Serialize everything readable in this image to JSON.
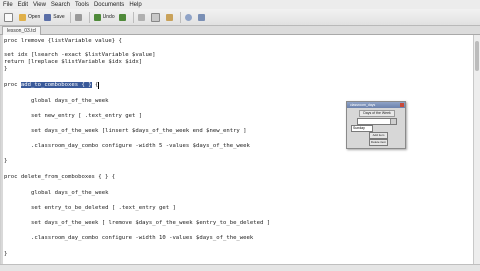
{
  "menu": [
    "File",
    "Edit",
    "View",
    "Search",
    "Tools",
    "Documents",
    "Help"
  ],
  "toolbar": {
    "open_label": "Open",
    "save_label": "Save",
    "undo_label": "Undo"
  },
  "tab": {
    "label": "lesson_03.tcl"
  },
  "code": {
    "l1": "proc lremove {listVariable value} {",
    "l2": "set idx [lsearch -exact $listVariable $value]",
    "l3": "return [lreplace $listVariable $idx $idx]",
    "l4": "}",
    "l5_pre": "proc ",
    "l5_sel": "add_to_comboboxes { }",
    "l5_post": " {",
    "l6": "global days_of_the_week",
    "l7": "set new_entry [ .text_entry get ]",
    "l8": "set days_of_the_week [linsert $days_of_the_week end $new_entry ]",
    "l9": ".classroom_day_combo configure -width 5 -values $days_of_the_week",
    "l10": "}",
    "l11": "proc delete_from_comboboxes { } {",
    "l12": "global days_of_the_week",
    "l13": "set entry_to_be_deleted [ .text_entry get ]",
    "l14": "set days_of_the_week [ lremove $days_of_the_week $entry_to_be_deleted ]",
    "l15": ".classroom_day_combo configure -width 10 -values $days_of_the_week",
    "l16": "}"
  },
  "tkwindow": {
    "title": "classroom_days",
    "label": "Days of the Week",
    "combo_value": "",
    "entry_value": "Sunday",
    "add_button": "Add item",
    "delete_button": "Delete item"
  },
  "colors": {
    "selection": "#3a5a9a",
    "titlebar": "#6c82ad"
  }
}
